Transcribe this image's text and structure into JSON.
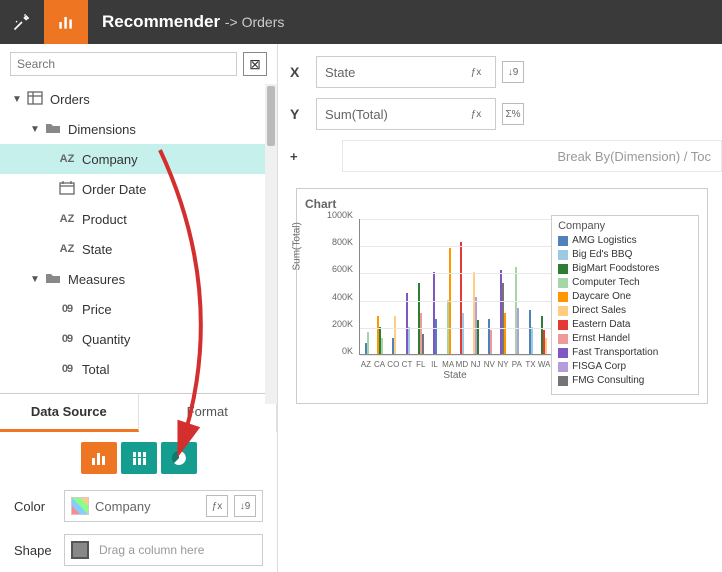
{
  "header": {
    "title": "Recommender",
    "arrow": "->",
    "sub": "Orders"
  },
  "search": {
    "placeholder": "Search"
  },
  "tree": {
    "root": {
      "label": "Orders"
    },
    "dimensions": {
      "label": "Dimensions",
      "items": [
        {
          "label": "Company",
          "type": "AZ",
          "selected": true
        },
        {
          "label": "Order Date",
          "type": "date"
        },
        {
          "label": "Product",
          "type": "AZ"
        },
        {
          "label": "State",
          "type": "AZ"
        }
      ]
    },
    "measures": {
      "label": "Measures",
      "items": [
        {
          "label": "Price",
          "type": "09"
        },
        {
          "label": "Quantity",
          "type": "09"
        },
        {
          "label": "Total",
          "type": "09"
        }
      ]
    }
  },
  "tabs": {
    "data_source": "Data Source",
    "format": "Format"
  },
  "encodings": {
    "color": {
      "label": "Color",
      "value": "Company"
    },
    "shape": {
      "label": "Shape",
      "placeholder": "Drag a column here"
    }
  },
  "axes": {
    "x": {
      "label": "X",
      "value": "State"
    },
    "y": {
      "label": "Y",
      "value": "Sum(Total)"
    },
    "break": "Break By(Dimension) / Toc"
  },
  "chart_data": {
    "type": "bar",
    "title": "Chart",
    "xlabel": "State",
    "ylabel": "Sum(Total)",
    "ylim": [
      0,
      1000
    ],
    "yticks": [
      0,
      200,
      400,
      600,
      800,
      1000
    ],
    "ytick_suffix": "K",
    "categories": [
      "AZ",
      "CA",
      "CO",
      "CT",
      "FL",
      "IL",
      "MA",
      "MD",
      "NJ",
      "NV",
      "NY",
      "PA",
      "TX",
      "WA"
    ],
    "legend_title": "Company",
    "series": [
      {
        "name": "AMG Logistics",
        "color": "#4f81bd"
      },
      {
        "name": "Big Ed's BBQ",
        "color": "#9ecae1"
      },
      {
        "name": "BigMart Foodstores",
        "color": "#2e7d32"
      },
      {
        "name": "Computer Tech",
        "color": "#a5d6a7"
      },
      {
        "name": "Daycare One",
        "color": "#ff9800"
      },
      {
        "name": "Direct Sales",
        "color": "#ffcc80"
      },
      {
        "name": "Eastern Data",
        "color": "#e53935"
      },
      {
        "name": "Ernst Handel",
        "color": "#ef9a9a"
      },
      {
        "name": "Fast Transportation",
        "color": "#7e57c2"
      },
      {
        "name": "FISGA Corp",
        "color": "#b39ddb"
      },
      {
        "name": "FMG Consulting",
        "color": "#757575"
      }
    ],
    "bars_by_category": {
      "AZ": [
        {
          "c": "#4f81bd",
          "v": 80
        },
        {
          "c": "#a5d6a7",
          "v": 160
        }
      ],
      "CA": [
        {
          "c": "#ff9800",
          "v": 280
        },
        {
          "c": "#2e7d32",
          "v": 200
        },
        {
          "c": "#a5d6a7",
          "v": 120
        }
      ],
      "CO": [
        {
          "c": "#4f81bd",
          "v": 120
        },
        {
          "c": "#ffcc80",
          "v": 280
        }
      ],
      "CT": [
        {
          "c": "#7e57c2",
          "v": 450
        },
        {
          "c": "#9ecae1",
          "v": 200
        }
      ],
      "FL": [
        {
          "c": "#2e7d32",
          "v": 520
        },
        {
          "c": "#ef9a9a",
          "v": 300
        },
        {
          "c": "#757575",
          "v": 150
        }
      ],
      "IL": [
        {
          "c": "#7e57c2",
          "v": 600
        },
        {
          "c": "#4f81bd",
          "v": 260
        }
      ],
      "MA": [
        {
          "c": "#a5d6a7",
          "v": 400
        },
        {
          "c": "#ff9800",
          "v": 780
        }
      ],
      "MD": [
        {
          "c": "#e53935",
          "v": 820
        },
        {
          "c": "#9ecae1",
          "v": 300
        }
      ],
      "NJ": [
        {
          "c": "#ffcc80",
          "v": 600
        },
        {
          "c": "#b39ddb",
          "v": 420
        },
        {
          "c": "#2e7d32",
          "v": 250
        }
      ],
      "NV": [
        {
          "c": "#4f81bd",
          "v": 260
        },
        {
          "c": "#ef9a9a",
          "v": 180
        }
      ],
      "NY": [
        {
          "c": "#7e57c2",
          "v": 620
        },
        {
          "c": "#757575",
          "v": 520
        },
        {
          "c": "#ff9800",
          "v": 300
        }
      ],
      "PA": [
        {
          "c": "#a5d6a7",
          "v": 640
        },
        {
          "c": "#b39ddb",
          "v": 340
        }
      ],
      "TX": [
        {
          "c": "#4f81bd",
          "v": 320
        },
        {
          "c": "#9ecae1",
          "v": 200
        }
      ],
      "WA": [
        {
          "c": "#2e7d32",
          "v": 280
        },
        {
          "c": "#e53935",
          "v": 180
        },
        {
          "c": "#ffcc80",
          "v": 120
        }
      ]
    }
  }
}
